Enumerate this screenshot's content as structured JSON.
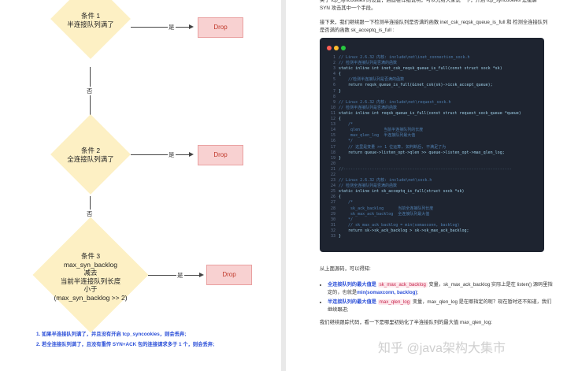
{
  "flowchart": {
    "cond1": [
      "条件 1",
      "半连接队列满了"
    ],
    "cond2": [
      "条件 2",
      "全连接队列满了"
    ],
    "cond3": [
      "条件 3",
      "max_syn_backlog",
      "减去",
      "当前半连接队列长度",
      "小于",
      "(max_syn_backlog >> 2)"
    ],
    "yes": "是",
    "no": "否",
    "drop": "Drop",
    "notes": [
      "1. 如果半连接队列满了，并且没有开启 tcp_syncookies，则会丢弃;",
      "2. 若全连接队列满了，且没有重传 SYN+ACK 包的连接请求多于 1 个，则会丢弃;"
    ]
  },
  "doc": {
    "intro_top": "关于 tcp_syncookies 的设置，后面在详细说明，可以先给大家说一下，开启 tcp_syncookies 是缓解 SYN 攻击其中一个手段。",
    "intro": "接下来，我们继续跟一下检测半连接队列是否满的函数 inet_csk_reqsk_queue_is_full 和 检测全连接队列是否满的函数 sk_acceptq_is_full :",
    "code_colors": [
      "#ff5f56",
      "#ffbd2e",
      "#27c93f"
    ],
    "code": [
      {
        "n": "1",
        "t": "// Linux 2.6.32 内核: include\\net\\inet_connection_sock.h",
        "k": "comment"
      },
      {
        "n": "2",
        "t": "// 检测半连接队列是否满的函数",
        "k": "comment"
      },
      {
        "n": "3",
        "t": "static inline int inet_csk_reqsk_queue_is_full(const struct sock *sk)",
        "k": "code"
      },
      {
        "n": "4",
        "t": "{",
        "k": "code"
      },
      {
        "n": "5",
        "t": "    //检测半连接队列是否满的函数",
        "k": "comment"
      },
      {
        "n": "6",
        "t": "    return reqsk_queue_is_full(&inet_csk(sk)->icsk_accept_queue);",
        "k": "code"
      },
      {
        "n": "7",
        "t": "}",
        "k": "code"
      },
      {
        "n": "8",
        "t": "",
        "k": "blank"
      },
      {
        "n": "9",
        "t": "// Linux 2.6.32 内核: include\\net\\request_sock.h",
        "k": "comment"
      },
      {
        "n": "10",
        "t": "// 检测半连接队列是否满的函数",
        "k": "comment"
      },
      {
        "n": "11",
        "t": "static inline int reqsk_queue_is_full(const struct request_sock_queue *queue)",
        "k": "code"
      },
      {
        "n": "12",
        "t": "{",
        "k": "code"
      },
      {
        "n": "13",
        "t": "    /*",
        "k": "comment"
      },
      {
        "n": "14",
        "t": "     qlen          当前半连接队列的长度",
        "k": "comment"
      },
      {
        "n": "15",
        "t": "     max_qlen_log  半连接队列最大值",
        "k": "comment"
      },
      {
        "n": "16",
        "t": "    */",
        "k": "comment"
      },
      {
        "n": "17",
        "t": "    // 这里是变量 >> 1 位运算, 如判断后, 不满足了为",
        "k": "comment"
      },
      {
        "n": "18",
        "t": "    return queue->listen_opt->qlen >> queue->listen_opt->max_qlen_log;",
        "k": "code"
      },
      {
        "n": "19",
        "t": "}",
        "k": "code"
      },
      {
        "n": "20",
        "t": "",
        "k": "blank"
      },
      {
        "n": "21",
        "t": "//-----------------------------------------------------------------------",
        "k": "sep"
      },
      {
        "n": "22",
        "t": "",
        "k": "blank"
      },
      {
        "n": "23",
        "t": "// Linux 2.6.32 内核: include\\net\\sock.h",
        "k": "comment"
      },
      {
        "n": "24",
        "t": "// 检测全连接队列是否满的函数",
        "k": "comment"
      },
      {
        "n": "25",
        "t": "static inline int sk_acceptq_is_full(struct sock *sk)",
        "k": "code"
      },
      {
        "n": "26",
        "t": "{",
        "k": "code"
      },
      {
        "n": "27",
        "t": "    /*",
        "k": "comment"
      },
      {
        "n": "28",
        "t": "     sk_ack_backlog      当前全连接队列长度",
        "k": "comment"
      },
      {
        "n": "29",
        "t": "     sk_max_ack_backlog  全连接队列最大值",
        "k": "comment"
      },
      {
        "n": "30",
        "t": "    */",
        "k": "comment"
      },
      {
        "n": "31",
        "t": "    // sk_max_ack_backlog = min(somaxconn, backlog)",
        "k": "comment"
      },
      {
        "n": "32",
        "t": "    return sk->sk_ack_backlog > sk->sk_max_ack_backlog;",
        "k": "code"
      },
      {
        "n": "33",
        "t": "}",
        "k": "code"
      }
    ],
    "after_code": "从上面源码，可以得知:",
    "bullet1": {
      "a": "全连接队列的最大值是",
      "tag1": "sk_max_ack_backlog",
      "b": "变量，sk_max_ack_backlog 实际上是在 listen() 源码里指定的，也就是",
      "strong": "min(somaxconn, backlog)",
      "c": ";"
    },
    "bullet2": {
      "a": "半连接队列的最大值是",
      "tag1": "max_qlen_log",
      "b": "变量，max_qlen_log 是在哪指定的呢？现在暂时还不知道，我们继续跟进;"
    },
    "closing": "我们继续跟踪代码，看一下是哪里初始化了半连接队列的最大值 max_qlen_log:",
    "watermark": "知乎 @java架构大集市"
  }
}
